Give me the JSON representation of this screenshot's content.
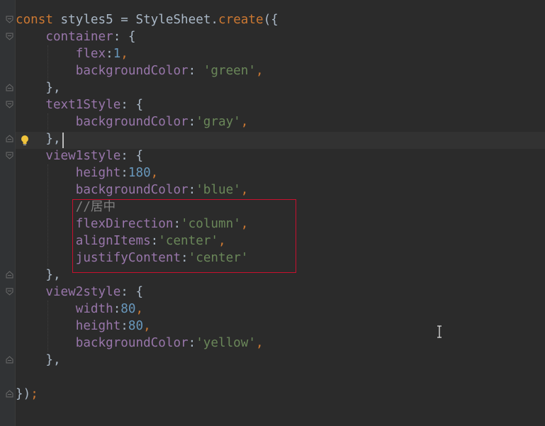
{
  "code_lines": [
    [
      {
        "t": "const",
        "c": "kw"
      },
      {
        "t": " styles5 = StyleSheet.",
        "c": "pn"
      },
      {
        "t": "create",
        "c": "kw"
      },
      {
        "t": "({",
        "c": "pn"
      }
    ],
    [
      {
        "t": "    container",
        "c": "prop"
      },
      {
        "t": ": {",
        "c": "pn"
      }
    ],
    [
      {
        "t": "        flex",
        "c": "key"
      },
      {
        "t": ":",
        "c": "pn"
      },
      {
        "t": "1",
        "c": "num"
      },
      {
        "t": ",",
        "c": "kw"
      }
    ],
    [
      {
        "t": "        backgroundColor",
        "c": "key"
      },
      {
        "t": ": ",
        "c": "pn"
      },
      {
        "t": "'green'",
        "c": "str"
      },
      {
        "t": ",",
        "c": "kw"
      }
    ],
    [
      {
        "t": "    },",
        "c": "pn"
      }
    ],
    [
      {
        "t": "    text1Style",
        "c": "prop"
      },
      {
        "t": ": {",
        "c": "pn"
      }
    ],
    [
      {
        "t": "        backgroundColor",
        "c": "key"
      },
      {
        "t": ":",
        "c": "pn"
      },
      {
        "t": "'gray'",
        "c": "str"
      },
      {
        "t": ",",
        "c": "kw"
      }
    ],
    [
      {
        "t": "    },",
        "c": "pn"
      }
    ],
    [
      {
        "t": "    view1style",
        "c": "prop"
      },
      {
        "t": ": {",
        "c": "pn"
      }
    ],
    [
      {
        "t": "        height",
        "c": "key"
      },
      {
        "t": ":",
        "c": "pn"
      },
      {
        "t": "180",
        "c": "num"
      },
      {
        "t": ",",
        "c": "kw"
      }
    ],
    [
      {
        "t": "        backgroundColor",
        "c": "key"
      },
      {
        "t": ":",
        "c": "pn"
      },
      {
        "t": "'blue'",
        "c": "str"
      },
      {
        "t": ",",
        "c": "kw"
      }
    ],
    [
      {
        "t": "        //居中",
        "c": "cmt"
      }
    ],
    [
      {
        "t": "        flexDirection",
        "c": "key"
      },
      {
        "t": ":",
        "c": "pn"
      },
      {
        "t": "'column'",
        "c": "str"
      },
      {
        "t": ",",
        "c": "kw"
      }
    ],
    [
      {
        "t": "        alignItems",
        "c": "key"
      },
      {
        "t": ":",
        "c": "pn"
      },
      {
        "t": "'center'",
        "c": "str"
      },
      {
        "t": ",",
        "c": "kw"
      }
    ],
    [
      {
        "t": "        justifyContent",
        "c": "key"
      },
      {
        "t": ":",
        "c": "pn"
      },
      {
        "t": "'center'",
        "c": "str"
      }
    ],
    [
      {
        "t": "    },",
        "c": "pn"
      }
    ],
    [
      {
        "t": "    view2style",
        "c": "prop"
      },
      {
        "t": ": {",
        "c": "pn"
      }
    ],
    [
      {
        "t": "        width",
        "c": "key"
      },
      {
        "t": ":",
        "c": "pn"
      },
      {
        "t": "80",
        "c": "num"
      },
      {
        "t": ",",
        "c": "kw"
      }
    ],
    [
      {
        "t": "        height",
        "c": "key"
      },
      {
        "t": ":",
        "c": "pn"
      },
      {
        "t": "80",
        "c": "num"
      },
      {
        "t": ",",
        "c": "kw"
      }
    ],
    [
      {
        "t": "        backgroundColor",
        "c": "key"
      },
      {
        "t": ":",
        "c": "pn"
      },
      {
        "t": "'yellow'",
        "c": "str"
      },
      {
        "t": ",",
        "c": "kw"
      }
    ],
    [
      {
        "t": "    },",
        "c": "pn"
      }
    ],
    [],
    [
      {
        "t": "})",
        "c": "pn"
      },
      {
        "t": ";",
        "c": "kw"
      }
    ]
  ],
  "colors": {
    "background": "#2b2b2b",
    "keyword": "#cc7832",
    "property": "#9876aa",
    "number": "#6897bb",
    "string": "#6a8759",
    "comment": "#808080",
    "highlight_box": "#c8102e"
  },
  "icons": {
    "intention": "lightbulb-icon",
    "fold": "fold-marker-icon",
    "cursor": "text-cursor-icon"
  }
}
